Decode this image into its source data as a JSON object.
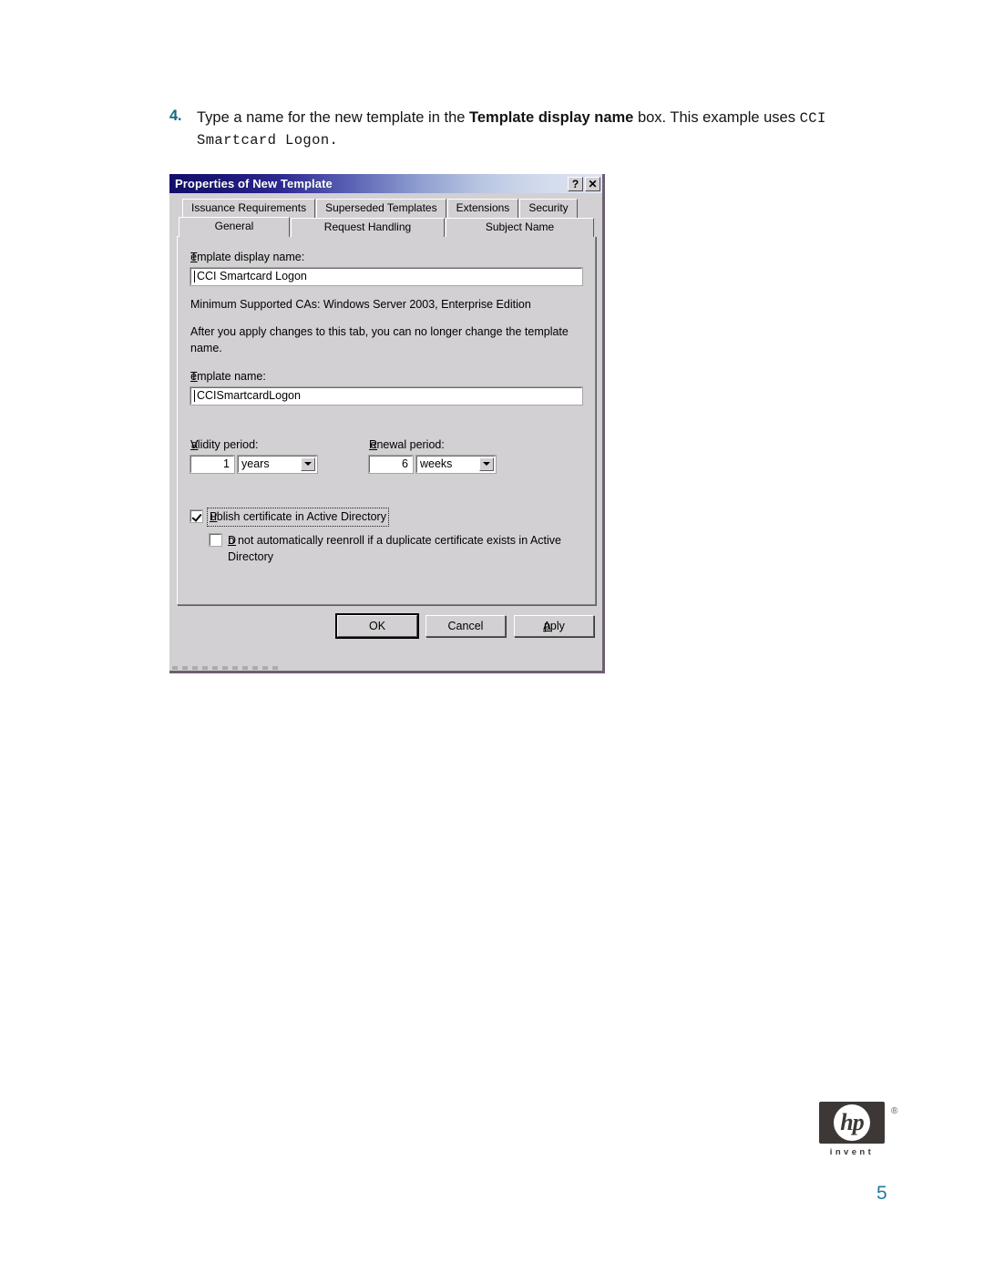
{
  "instruction": {
    "number": "4.",
    "text_part1": "Type a name for the new template in the ",
    "bold_part": "Template display name",
    "text_part2": " box. This example uses ",
    "mono_part1": "CCI",
    "mono_part2": "Smartcard Logon."
  },
  "dialog": {
    "title": "Properties of New Template",
    "titlebar_buttons": {
      "help": "?",
      "close": "✕"
    },
    "tabs_row1": [
      {
        "label": "Issuance Requirements"
      },
      {
        "label": "Superseded Templates"
      },
      {
        "label": "Extensions"
      },
      {
        "label": "Security"
      }
    ],
    "tabs_row2": [
      {
        "label": "General",
        "active": true
      },
      {
        "label": "Request Handling",
        "active": false
      },
      {
        "label": "Subject Name",
        "active": false
      }
    ],
    "general_tab": {
      "display_name_label": "Template display name:",
      "display_name_value": "CCI Smartcard Logon",
      "min_ca_line": "Minimum Supported CAs:  Windows Server 2003, Enterprise Edition",
      "warning_line": "After you apply changes to this tab, you can no longer change the template name.",
      "template_name_label": "Template name:",
      "template_name_value": "CCISmartcardLogon",
      "validity_label": "Validity period:",
      "validity_value": "1",
      "validity_unit": "years",
      "renewal_label": "Renewal period:",
      "renewal_value": "6",
      "renewal_unit": "weeks",
      "publish_checkbox_label": "Publish certificate in Active Directory",
      "publish_checkbox_checked": true,
      "reenroll_checkbox_label": "Do not automatically reenroll if a duplicate certificate exists in Active Directory",
      "reenroll_checkbox_checked": false
    },
    "buttons": {
      "ok": "OK",
      "cancel": "Cancel",
      "apply": "Apply"
    }
  },
  "footer": {
    "hp_wordmark": "hp",
    "hp_tagline": "invent",
    "hp_registered": "®",
    "page_number": "5"
  },
  "colors": {
    "accent_teal": "#0e6b82",
    "page_number": "#1d7e9c",
    "dialog_face": "#d2d0d2",
    "titlebar_start": "#120f6b",
    "titlebar_end": "#dfe4f2"
  }
}
